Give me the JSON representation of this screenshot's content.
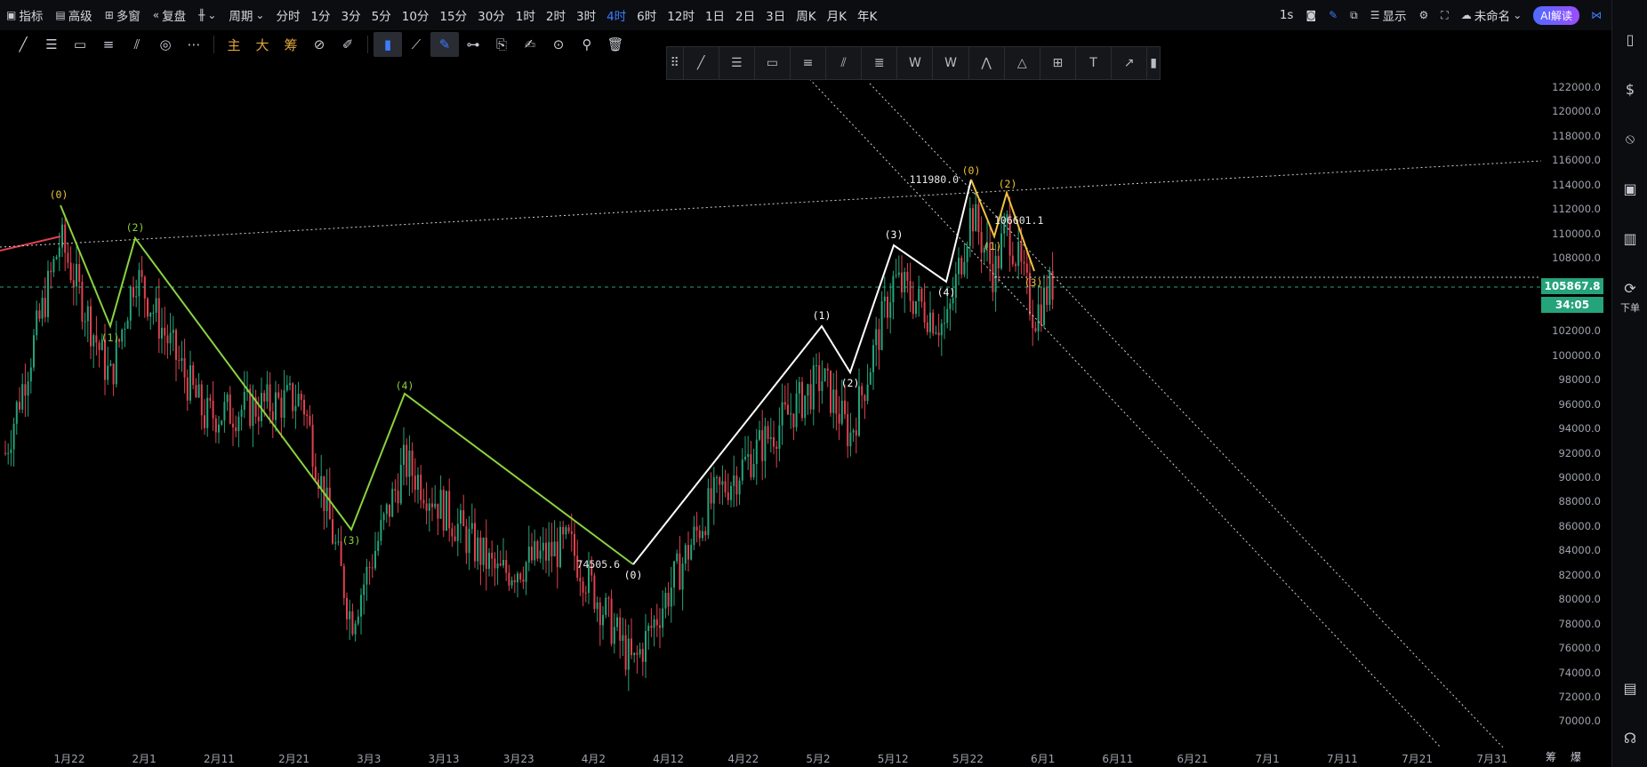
{
  "topbar": {
    "left": [
      {
        "icon": "indicator-icon",
        "label": "指标"
      },
      {
        "icon": "advanced-icon",
        "label": "高级"
      },
      {
        "icon": "multi-window-icon",
        "label": "多窗"
      },
      {
        "icon": "replay-icon",
        "label": "复盘"
      },
      {
        "icon": "candle-type-icon",
        "label": ""
      },
      {
        "icon": "chevron-down-icon",
        "label": "周期"
      }
    ],
    "periods": [
      "分时",
      "1分",
      "3分",
      "5分",
      "10分",
      "15分",
      "30分",
      "1时",
      "2时",
      "3时",
      "4时",
      "6时",
      "12时",
      "1日",
      "2日",
      "3日",
      "周K",
      "月K",
      "年K"
    ],
    "active_period": "4时",
    "right": {
      "interval": "1s",
      "display_label": "显示",
      "layout_name": "未命名",
      "ai_label": "AI解读"
    }
  },
  "chart": {
    "price_ticks": [
      "122000.0",
      "120000.0",
      "118000.0",
      "116000.0",
      "114000.0",
      "112000.0",
      "110000.0",
      "108000.0",
      "106000.0",
      "102000.0",
      "100000.0",
      "98000.0",
      "96000.0",
      "94000.0",
      "92000.0",
      "90000.0",
      "88000.0",
      "86000.0",
      "84000.0",
      "82000.0",
      "80000.0",
      "78000.0",
      "76000.0",
      "74000.0",
      "72000.0",
      "70000.0"
    ],
    "current_price": "105867.8",
    "countdown": "34:05",
    "time_ticks": [
      "1月22",
      "2月1",
      "2月11",
      "2月21",
      "3月3",
      "3月13",
      "3月23",
      "4月2",
      "4月12",
      "4月22",
      "5月2",
      "5月12",
      "5月22",
      "6月1",
      "6月11",
      "6月21",
      "7月1",
      "7月11",
      "7月21",
      "7月31"
    ],
    "annotations": {
      "low": "74505.6",
      "high": "111980.0",
      "mid": "106601.1"
    },
    "wave_labels_green": [
      "(0)",
      "(1)",
      "(2)",
      "(3)",
      "(4)"
    ],
    "wave_labels_white": [
      "(0)",
      "(1)",
      "(2)",
      "(3)",
      "(4)"
    ],
    "wave_labels_yellow": [
      "(0)",
      "(1)",
      "(2)",
      "(3)"
    ]
  },
  "sidebar": {
    "order_label": "下单"
  },
  "bottom": {
    "label_a": "筹",
    "label_b": "爆"
  },
  "colors": {
    "up": "#25a37a",
    "down": "#e0414f",
    "green_wave": "#8bd23e",
    "yellow_wave": "#f0c23c",
    "accent": "#3d7bff"
  }
}
